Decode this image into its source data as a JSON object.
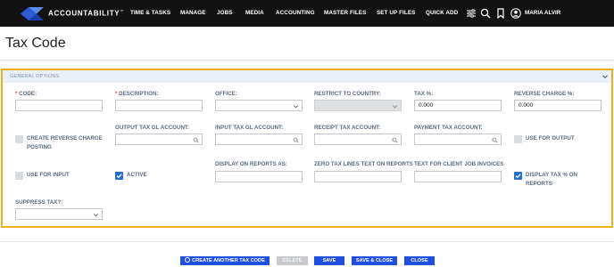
{
  "nav": {
    "brand": "ACCOUNTABILITY",
    "brand_mark": "™",
    "items": [
      "TIME & TASKS",
      "MANAGE",
      "JOBS",
      "MEDIA",
      "ACCOUNTING",
      "MASTER FILES",
      "SET UP FILES",
      "QUICK ADD"
    ],
    "user": "MARIA ALVIR",
    "icons": [
      "sliders-icon",
      "search-icon",
      "bookmark-icon",
      "user-circle-icon"
    ]
  },
  "page": {
    "title": "Tax Code"
  },
  "panel": {
    "header": "GENERAL OPTIONS"
  },
  "fields": {
    "code": {
      "label": "CODE:",
      "value": ""
    },
    "description": {
      "label": "DESCRIPTION:",
      "value": ""
    },
    "office": {
      "label": "OFFICE:",
      "value": ""
    },
    "restrict_country": {
      "label": "RESTRICT TO COUNTRY:",
      "value": ""
    },
    "tax_pct": {
      "label": "TAX %:",
      "value": "0.000"
    },
    "reverse_charge_pct": {
      "label": "REVERSE CHARGE %:",
      "value": "0.000"
    },
    "output_gl": {
      "label": "OUTPUT TAX GL ACCOUNT:",
      "value": ""
    },
    "input_gl": {
      "label": "INPUT TAX GL ACCOUNT:",
      "value": ""
    },
    "receipt_tax": {
      "label": "RECEIPT TAX ACCOUNT:",
      "value": ""
    },
    "payment_tax": {
      "label": "PAYMENT TAX ACCOUNT:",
      "value": ""
    },
    "display_reports_as": {
      "label": "DISPLAY ON REPORTS AS:",
      "value": ""
    },
    "zero_tax_text": {
      "label": "ZERO TAX LINES TEXT ON REPORTS",
      "value": ""
    },
    "client_job_text": {
      "label": "TEXT FOR CLIENT JOB INVOICES",
      "value": ""
    },
    "suppress_tax": {
      "label": "SUPPRESS TAX?:",
      "value": ""
    }
  },
  "checkboxes": {
    "create_reverse": {
      "label": "CREATE REVERSE CHARGE POSTING",
      "checked": false
    },
    "use_for_output": {
      "label": "USE FOR OUTPUT",
      "checked": false
    },
    "use_for_input": {
      "label": "USE FOR INPUT",
      "checked": false
    },
    "active": {
      "label": "ACTIVE",
      "checked": true
    },
    "display_tax_pct": {
      "label": "DISPLAY TAX % ON REPORTS",
      "checked": true
    }
  },
  "footer": {
    "create_another": "CREATE ANOTHER TAX CODE",
    "delete": "DELETE",
    "save": "SAVE",
    "save_close": "SAVE & CLOSE",
    "close": "CLOSE"
  },
  "colors": {
    "accent": "#1f4fe0",
    "checkbox_on": "#1f6fd6",
    "panel_border": "#f0ad1e",
    "required": "#e03a3a",
    "topbar": "#121212"
  }
}
